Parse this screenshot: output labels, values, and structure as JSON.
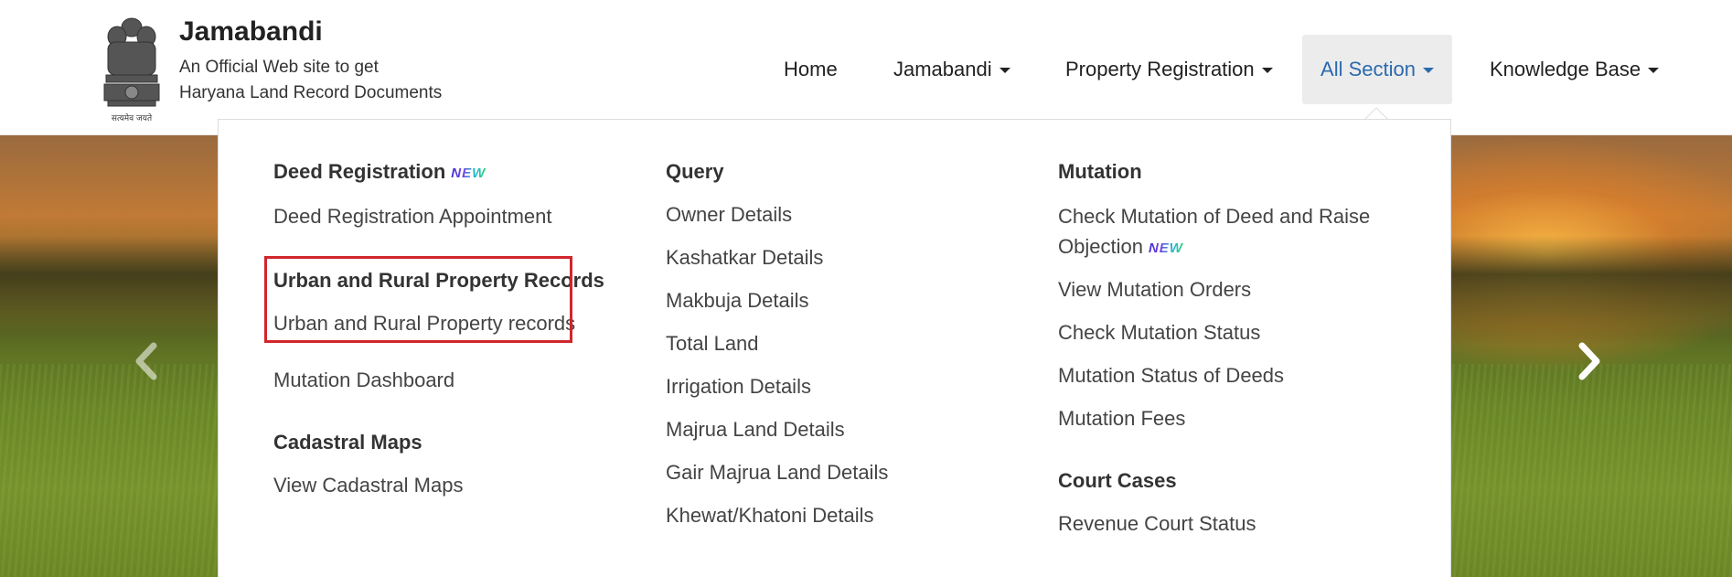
{
  "brand": {
    "title": "Jamabandi",
    "subtitle_line1": "An Official Web site to get",
    "subtitle_line2": "Haryana Land Record Documents",
    "emblem_text": "सत्यमेव जयते"
  },
  "nav": {
    "items": [
      {
        "label": "Home",
        "has_caret": false
      },
      {
        "label": "Jamabandi",
        "has_caret": true
      },
      {
        "label": "Property Registration",
        "has_caret": true
      },
      {
        "label": "All Section",
        "has_caret": true,
        "active": true
      },
      {
        "label": "Knowledge Base",
        "has_caret": true
      }
    ]
  },
  "dropdown": {
    "col1": {
      "deed_title": "Deed Registration",
      "deed_new": "NEW",
      "deed_link": "Deed Registration Appointment",
      "urban_title": "Urban and Rural Property Records",
      "urban_link": "Urban and Rural Property records",
      "mutation_dashboard": "Mutation Dashboard",
      "cadastral_title": "Cadastral Maps",
      "cadastral_link": "View Cadastral Maps"
    },
    "col2": {
      "title": "Query",
      "links": [
        "Owner Details",
        "Kashatkar Details",
        "Makbuja Details",
        "Total Land",
        "Irrigation Details",
        "Majrua Land Details",
        "Gair Majrua Land Details",
        "Khewat/Khatoni Details"
      ]
    },
    "col3": {
      "mutation_title": "Mutation",
      "check_mutation_line1": "Check Mutation of Deed and Raise",
      "check_mutation_line2": "Objection",
      "check_mutation_new": "NEW",
      "links": [
        "View Mutation Orders",
        "Check Mutation Status",
        "Mutation Status of Deeds",
        "Mutation Fees"
      ],
      "court_title": "Court Cases",
      "court_link": "Revenue Court Status"
    }
  },
  "colors": {
    "active_nav": "#2a6aad",
    "highlight": "#d0262b"
  },
  "icons": {
    "emblem": "national-emblem-icon",
    "prev": "chevron-left-icon",
    "next": "chevron-right-icon",
    "caret": "caret-down-icon"
  }
}
